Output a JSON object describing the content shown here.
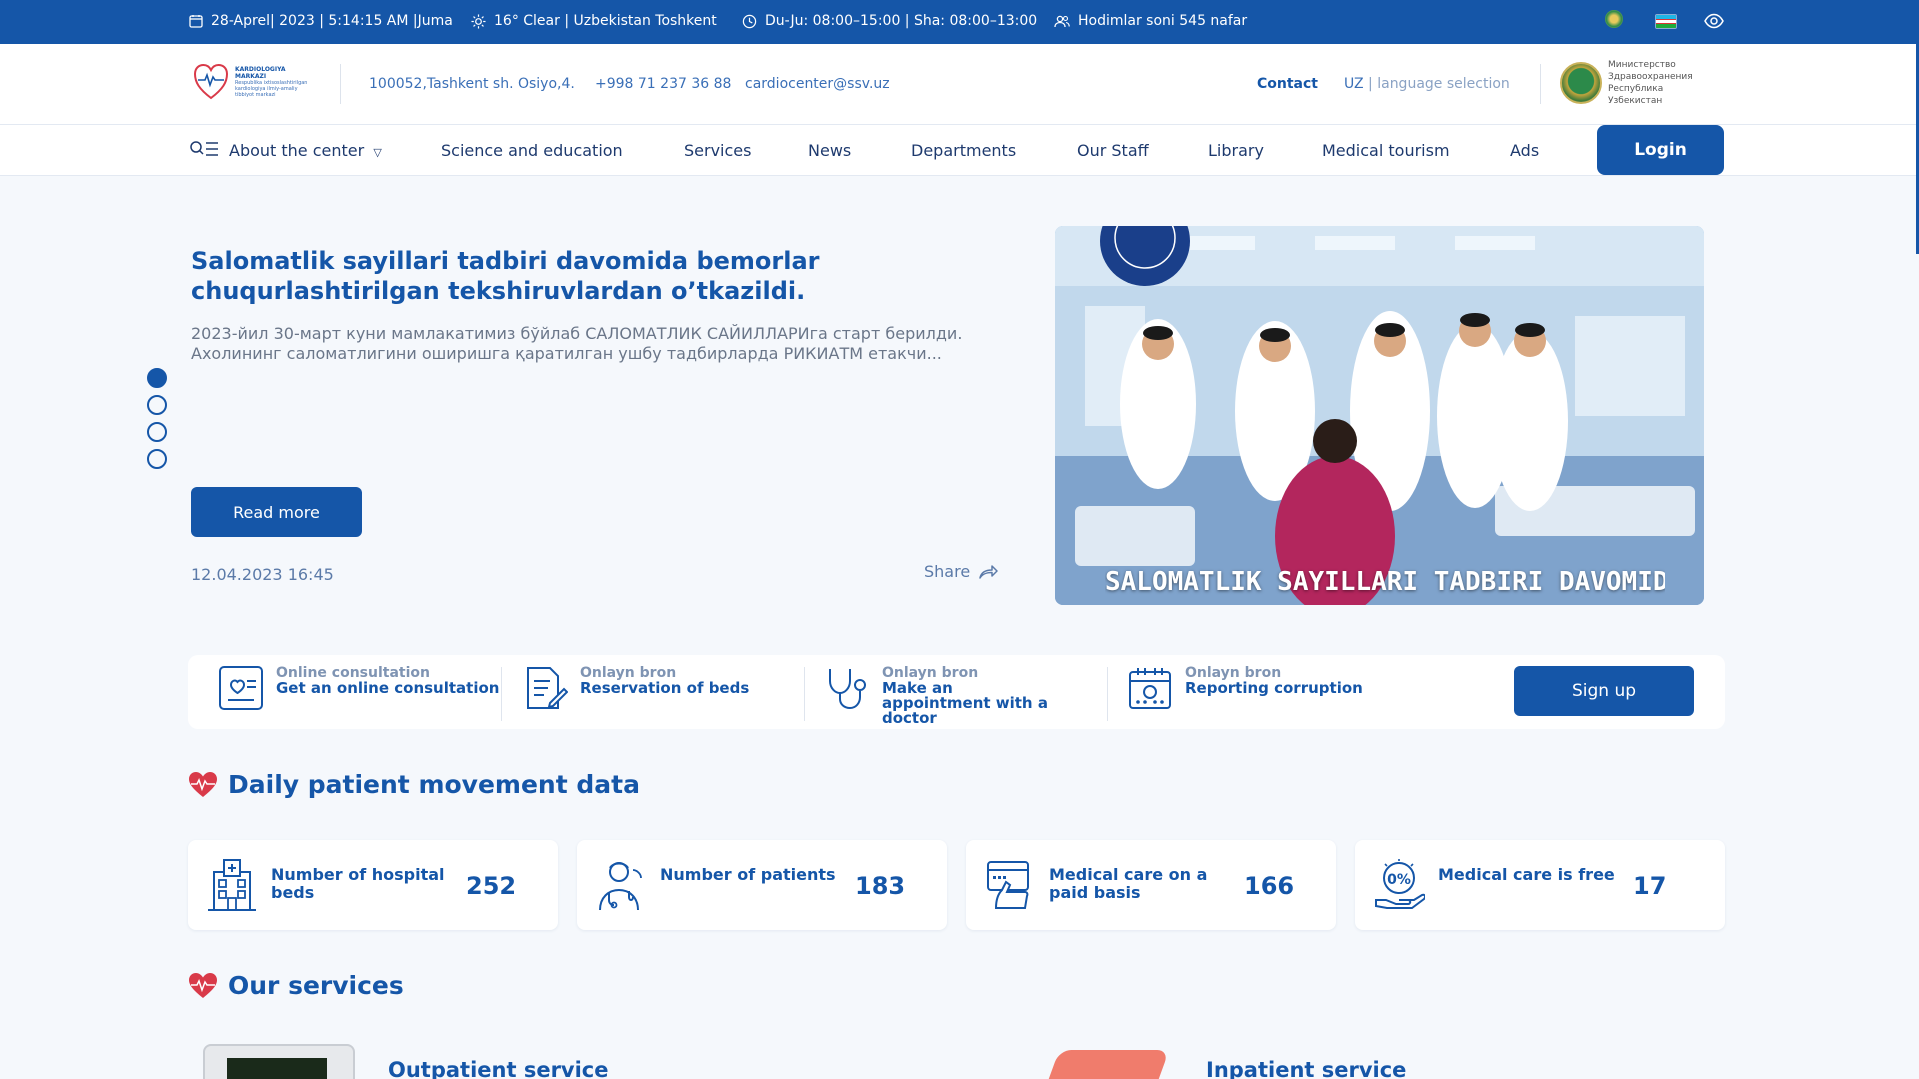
{
  "topbar": {
    "date": "28-Aprel| 2023 | 5:14:15 AM |Juma",
    "weather": "16° Clear | Uzbekistan Toshkent",
    "hours": "Du-Ju: 08:00–15:00 | Sha: 08:00–13:00",
    "staff": "Hodimlar soni 545 nafar"
  },
  "header": {
    "logo_title": "KARDIOLOGIYA MARKAZI",
    "logo_subtitle": "Respublika ixtisoslashtirilgan kardiologiya ilmiy-amaliy tibbiyot markazi",
    "address": "100052,Tashkent sh. Osiyo,4.",
    "phone": "+998 71 237 36 88",
    "email": "cardiocenter@ssv.uz",
    "contact": "Contact",
    "lang_code": "UZ",
    "lang_label": "language selection",
    "ministry": "Министерство Здравоохранения Республика Узбекистан"
  },
  "nav": {
    "items": [
      "About the center",
      "Science and education",
      "Services",
      "News",
      "Departments",
      "Our Staff",
      "Library",
      "Medical tourism",
      "Ads"
    ],
    "login": "Login"
  },
  "hero": {
    "title": "Salomatlik sayillari tadbiri davomida bemorlar chuqurlashtirilgan tekshiruvlardan o’tkazildi.",
    "text": "2023-йил 30-март куни мамлакатимиз бўйлаб САЛОМАТЛИК САЙИЛЛАРИга старт берилди. Ахолининг саломатлигини оширишга қаратилган ушбу тадбирларда РИКИАТМ етакчи...",
    "read_more": "Read more",
    "date": "12.04.2023 16:45",
    "share": "Share",
    "image_caption": "SALOMATLIK SAYILLARI TADBIRI DAVOMIDA BEMORLAR CHUQURLASHTIRILGAN",
    "slides_total": 4,
    "slide_active": 1
  },
  "strip": {
    "items": [
      {
        "small": "Online consultation",
        "big": "Get an online consultation",
        "icon": "heart-chat-icon"
      },
      {
        "small": "Onlayn bron",
        "big": "Reservation of beds",
        "icon": "document-pen-icon"
      },
      {
        "small": "Onlayn bron",
        "big": "Make an appointment with a doctor",
        "icon": "stethoscope-icon"
      },
      {
        "small": "Onlayn bron",
        "big": "Reporting corruption",
        "icon": "calendar-icon"
      }
    ],
    "signup": "Sign up"
  },
  "daily": {
    "heading": "Daily patient movement data",
    "stats": [
      {
        "label": "Number of hospital beds",
        "value": "252",
        "icon": "hospital-icon"
      },
      {
        "label": "Number of patients",
        "value": "183",
        "icon": "doctor-icon"
      },
      {
        "label": "Medical care on a paid basis",
        "value": "166",
        "icon": "card-payment-icon"
      },
      {
        "label": "Medical care is free",
        "value": "17",
        "icon": "zero-percent-hand-icon"
      }
    ]
  },
  "services": {
    "heading": "Our services",
    "items": [
      "Outpatient service",
      "Inpatient service"
    ]
  },
  "colors": {
    "primary": "#1556a8",
    "accent": "#d93a49",
    "background": "#f5f8fc"
  }
}
